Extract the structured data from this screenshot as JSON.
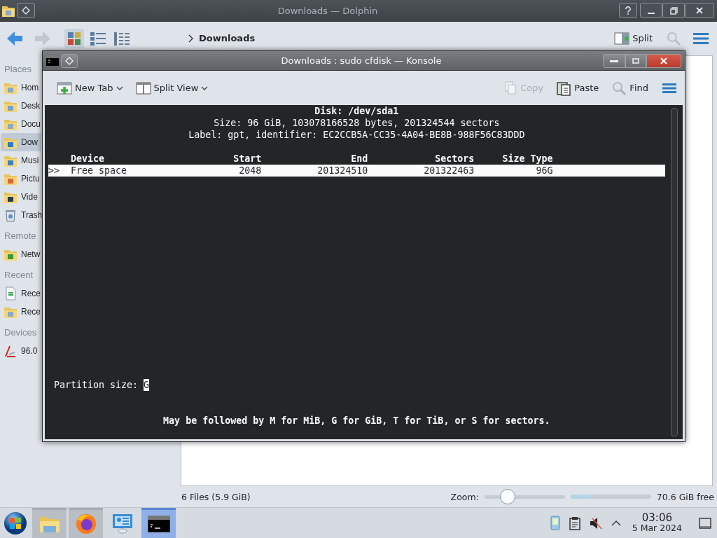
{
  "dolphin": {
    "title": "Downloads — Dolphin",
    "toolbar": {
      "breadcrumb": "Downloads",
      "split": "Split"
    },
    "sidebar": {
      "sections": [
        {
          "heading": "Places",
          "items": [
            {
              "label": "Hom",
              "kind": "home",
              "selected": false
            },
            {
              "label": "Desk",
              "kind": "desktop",
              "selected": false
            },
            {
              "label": "Docu",
              "kind": "documents",
              "selected": false
            },
            {
              "label": "Dow",
              "kind": "downloads",
              "selected": true
            },
            {
              "label": "Musi",
              "kind": "music",
              "selected": false
            },
            {
              "label": "Pictu",
              "kind": "pictures",
              "selected": false
            },
            {
              "label": "Vide",
              "kind": "videos",
              "selected": false
            },
            {
              "label": "Trash",
              "kind": "trash",
              "selected": false
            }
          ]
        },
        {
          "heading": "Remote",
          "items": [
            {
              "label": "Netw",
              "kind": "network",
              "selected": false
            }
          ]
        },
        {
          "heading": "Recent",
          "items": [
            {
              "label": "Rece",
              "kind": "recent-files",
              "selected": false
            },
            {
              "label": "Rece",
              "kind": "recent-folders",
              "selected": false
            }
          ]
        },
        {
          "heading": "Devices",
          "items": [
            {
              "label": "96.0",
              "kind": "drive",
              "selected": false
            }
          ]
        }
      ]
    },
    "status": {
      "files": "6 Files (5.9 GiB)",
      "zoom_label": "Zoom:",
      "zoom": {
        "level": 0.29
      },
      "free_space": {
        "level": 0.25
      },
      "free": "70.6 GiB free"
    }
  },
  "konsole": {
    "title": "Downloads : sudo cfdisk — Konsole",
    "toolbar": {
      "buttons": [
        {
          "label": "New Tab",
          "kind": "new-tab",
          "menu": true,
          "disabled": false
        },
        {
          "label": "Split View",
          "kind": "split-view",
          "menu": true,
          "disabled": false
        },
        {
          "label": "Copy",
          "kind": "copy",
          "menu": false,
          "disabled": true
        },
        {
          "label": "Paste",
          "kind": "paste",
          "menu": false,
          "disabled": false
        },
        {
          "label": "Find",
          "kind": "find",
          "menu": false,
          "disabled": false
        }
      ]
    },
    "terminal": {
      "header": [
        "Disk: /dev/sda1",
        "Size: 96 GiB, 103078166528 bytes, 201324544 sectors",
        "Label: gpt, identifier: EC2CCB5A-CC35-4A04-BE8B-988F56C83DDD"
      ],
      "columns": [
        "Device",
        "Start",
        "End",
        "Sectors",
        "Size",
        "Type"
      ],
      "rows": [
        {
          "marker": ">>",
          "cells": [
            "Free space",
            "2048",
            "201324510",
            "201322463",
            "",
            "96G"
          ],
          "selected": true
        }
      ],
      "prompt": "Partition size:",
      "input": "G",
      "hint": "May be followed by M for MiB, G for GiB, T for TiB, or S for sectors."
    }
  },
  "taskbar": {
    "apps": [
      {
        "kind": "folder",
        "running": true,
        "selected": false
      },
      {
        "kind": "browser",
        "running": true,
        "selected": false
      },
      {
        "kind": "settings",
        "running": false,
        "selected": false
      },
      {
        "kind": "terminal",
        "running": true,
        "selected": true
      }
    ],
    "clock": {
      "time": "03:06",
      "date": "5 Mar 2024"
    }
  }
}
